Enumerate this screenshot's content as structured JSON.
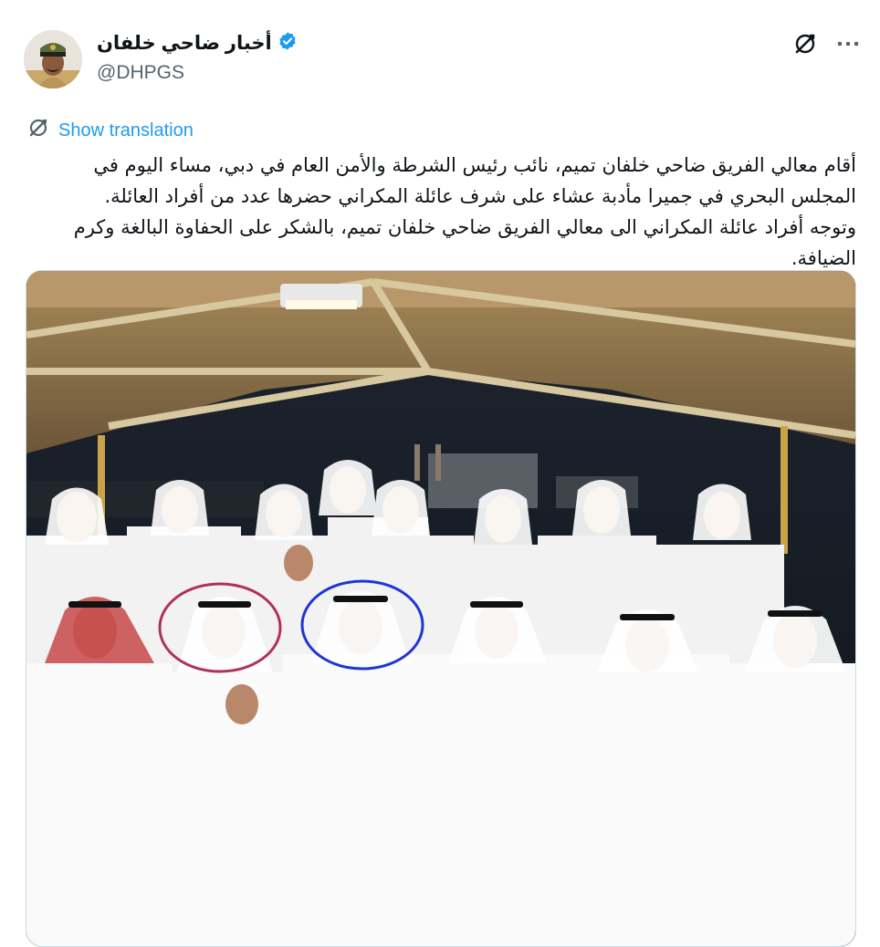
{
  "author": {
    "display_name": "أخبار ضاحي خلفان",
    "handle": "@DHPGS",
    "verified": true,
    "avatar_icon": "officer-avatar"
  },
  "actions": {
    "grok_icon": "grok-icon",
    "more_icon": "more-dots-icon"
  },
  "translation": {
    "label": "Show translation",
    "icon": "translate-icon"
  },
  "tweet": {
    "paragraph_1": "أقام معالي الفريق ضاحي خلفان تميم، نائب رئيس الشرطة والأمن العام في دبي، مساء اليوم في المجلس البحري في جميرا مأدبة عشاء على شرف عائلة المكراني حضرها عدد من أفراد العائلة.",
    "paragraph_2": "وتوجه أفراد عائلة المكراني الى معالي الفريق ضاحي خلفان تميم، بالشكر على الحفاوة البالغة وكرم الضيافة."
  },
  "media": {
    "type": "photo",
    "highlight_colors": {
      "circle_left": "#b03060",
      "circle_right": "#1f35d6"
    }
  },
  "colors": {
    "accent": "#1d9bf0",
    "muted": "#536471",
    "text": "#0f1419"
  }
}
